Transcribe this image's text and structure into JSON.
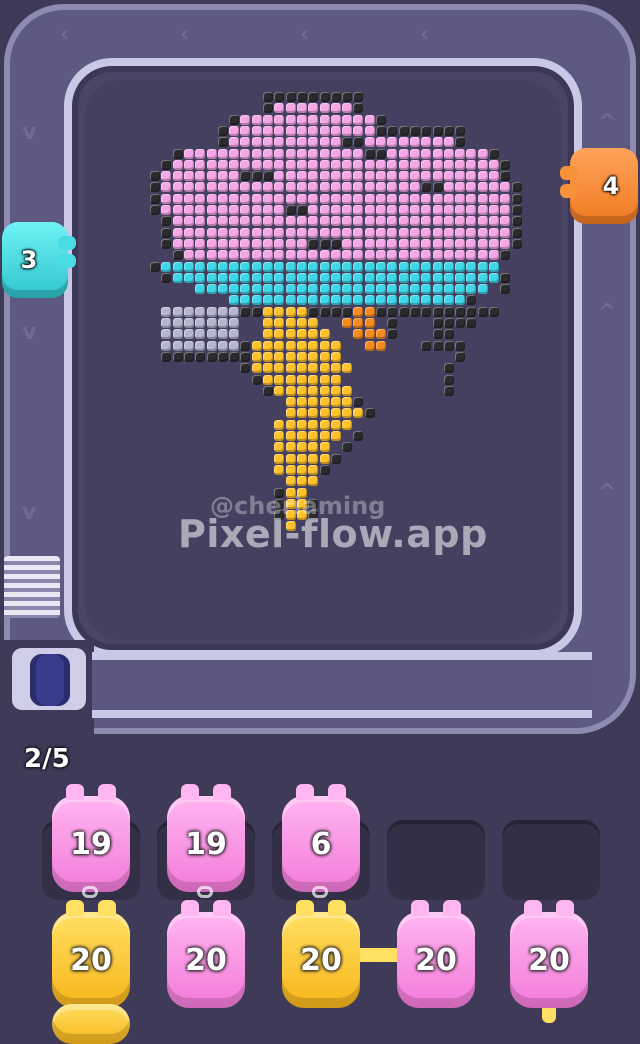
{
  "watermark": {
    "handle": "@cheriaming",
    "site": "Pixel-flow.app"
  },
  "progress_counter": "2/5",
  "shooters": {
    "left": {
      "count": "3",
      "color": "#45dde2"
    },
    "right": {
      "count": "4",
      "color": "#f58a33"
    }
  },
  "queue_row1": [
    {
      "count": "19",
      "color": "pink"
    },
    {
      "count": "19",
      "color": "pink"
    },
    {
      "count": "6",
      "color": "pink"
    },
    {
      "count": "",
      "color": "empty"
    },
    {
      "count": "",
      "color": "empty"
    }
  ],
  "queue_row2": [
    {
      "count": "20",
      "color": "yellow"
    },
    {
      "count": "20",
      "color": "pink"
    },
    {
      "count": "20",
      "color": "yellow"
    },
    {
      "count": "20",
      "color": "pink"
    },
    {
      "count": "20",
      "color": "pink"
    }
  ],
  "palette": {
    "pink": "#f4a6e6",
    "cyan": "#3ed7ea",
    "yellow": "#ffc22b",
    "orange": "#f58a20",
    "gray": "#b6b6d0",
    "dark": "#2b2b2f"
  },
  "pixel_art_subject": "thunder-cloud"
}
